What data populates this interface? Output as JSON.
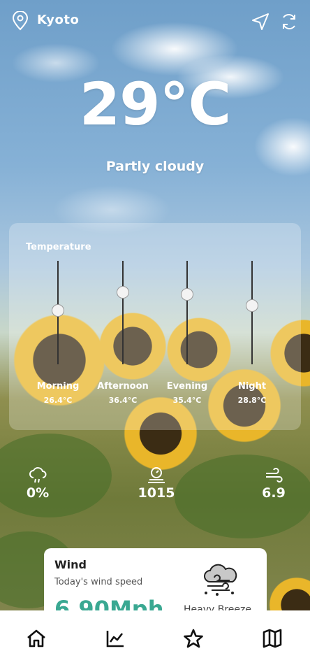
{
  "location": {
    "city": "Kyoto"
  },
  "current": {
    "temperature": "29°C",
    "condition": "Partly cloudy"
  },
  "temperature_card": {
    "title": "Temperature",
    "periods": [
      {
        "label": "Morning",
        "temp": "26.4°C"
      },
      {
        "label": "Afternoon",
        "temp": "36.4°C"
      },
      {
        "label": "Evening",
        "temp": "35.4°C"
      },
      {
        "label": "Night",
        "temp": "28.8°C"
      }
    ]
  },
  "stats": {
    "precipitation": "0%",
    "pressure": "1015",
    "wind": "6.9"
  },
  "wind_card": {
    "title": "Wind",
    "subtitle": "Today's wind speed",
    "speed": "6.90Mph",
    "description": "Heavy Breeze"
  },
  "bottom_nav": {
    "items": [
      "home-icon",
      "chart-icon",
      "star-icon",
      "map-icon"
    ]
  },
  "colors": {
    "wind_value": "#3aa892",
    "nav_background": "#ffffff"
  }
}
